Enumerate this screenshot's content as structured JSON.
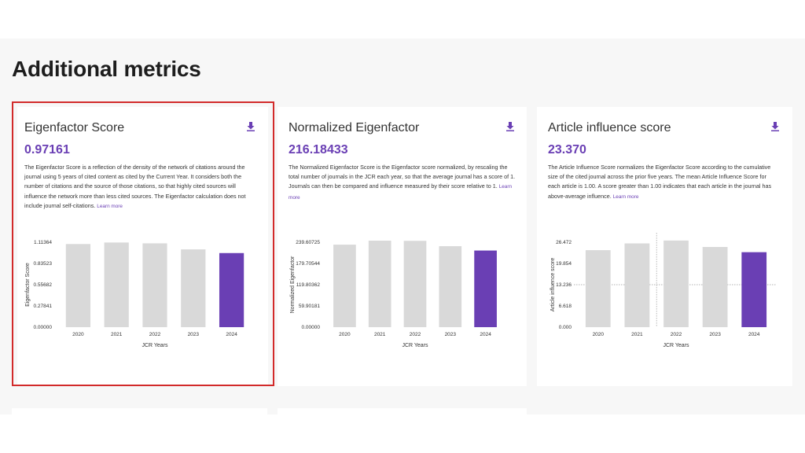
{
  "page": {
    "title": "Additional metrics"
  },
  "colors": {
    "accent": "#6a3fb4",
    "bar": "#d9d9d9",
    "highlight": "#d22a2a"
  },
  "cards": [
    {
      "title": "Eigenfactor Score",
      "value": "0.97161",
      "description": "The Eigenfactor Score is a reflection of the density of the network of citations around the journal using 5 years of cited content as cited by the Current Year. It considers both the number of citations and the source of those citations, so that highly cited sources will influence the network more than less cited sources. The Eigenfactor calculation does not include journal self-citations.",
      "learn_more": "Learn more",
      "download_icon": "download-icon"
    },
    {
      "title": "Normalized Eigenfactor",
      "value": "216.18433",
      "description": "The Normalized Eigenfactor Score is the Eigenfactor score normalized, by rescaling the total number of journals in the JCR each year, so that the average journal has a score of 1. Journals can then be compared and influence measured by their score relative to 1.",
      "learn_more": "Learn more",
      "download_icon": "download-icon"
    },
    {
      "title": "Article influence score",
      "value": "23.370",
      "description": "The Article Influence Score normalizes the Eigenfactor Score according to the cumulative size of the cited journal across the prior five years. The mean Article Influence Score for each article is 1.00. A score greater than 1.00 indicates that each article in the journal has above-average influence.",
      "learn_more": "Learn more",
      "download_icon": "download-icon"
    }
  ],
  "chart_data": [
    {
      "type": "bar",
      "categories": [
        "2020",
        "2021",
        "2022",
        "2023",
        "2024"
      ],
      "values": [
        1.09,
        1.11,
        1.099,
        1.02,
        0.97161
      ],
      "highlight_index": 4,
      "xlabel": "JCR Years",
      "ylabel": "Eigenfactor Score",
      "yticks": [
        "0.00000",
        "0.27841",
        "0.55682",
        "0.83523",
        "1.11364"
      ],
      "ylim": [
        0,
        1.11364
      ],
      "grid": false
    },
    {
      "type": "bar",
      "categories": [
        "2020",
        "2021",
        "2022",
        "2023",
        "2024"
      ],
      "values": [
        232.8,
        244.0,
        243.5,
        228.4,
        216.18433
      ],
      "highlight_index": 4,
      "xlabel": "JCR Years",
      "ylabel": "Normalized Eigenfactor",
      "yticks": [
        "0.00000",
        "59.90181",
        "119.80362",
        "179.70544",
        "239.60725"
      ],
      "ylim": [
        0,
        239.60725
      ],
      "grid": false
    },
    {
      "type": "bar",
      "categories": [
        "2020",
        "2021",
        "2022",
        "2023",
        "2024"
      ],
      "values": [
        24.0,
        26.1,
        27.0,
        25.0,
        23.37
      ],
      "highlight_index": 4,
      "xlabel": "JCR Years",
      "ylabel": "Article influence score",
      "yticks": [
        "0.000",
        "6.618",
        "13.236",
        "19.854",
        "26.472"
      ],
      "ylim": [
        0,
        26.472
      ],
      "grid": false,
      "crosshair": {
        "x": "2021",
        "y": 13.236
      }
    }
  ]
}
